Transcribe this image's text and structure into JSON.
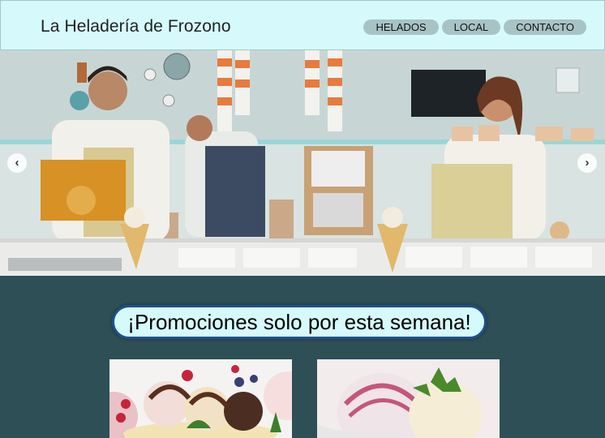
{
  "header": {
    "brand": "La Heladería de Frozono",
    "nav": [
      {
        "label": "HELADOS"
      },
      {
        "label": "LOCAL"
      },
      {
        "label": "CONTACTO"
      }
    ]
  },
  "hero": {
    "prev_icon": "chevron-left-icon",
    "next_icon": "chevron-right-icon",
    "prev_glyph": "‹",
    "next_glyph": "›"
  },
  "promo": {
    "title": "¡Promociones solo por esta semana!"
  },
  "colors": {
    "header_bg": "#d6fafc",
    "nav_pill": "#a8c3c6",
    "band_bg": "#2d4f55",
    "title_border": "#1f4f8f"
  }
}
